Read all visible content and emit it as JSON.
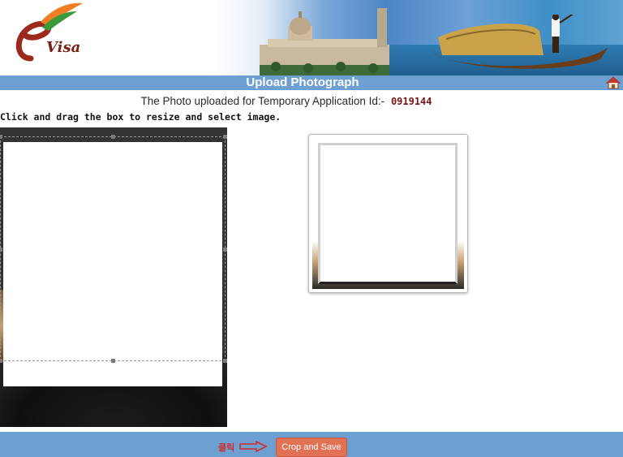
{
  "header": {
    "logo_text": "Visa",
    "page_title": "Upload Photograph"
  },
  "main": {
    "subtitle_prefix": "The Photo uploaded for Temporary Application Id:-",
    "application_id": "0919144",
    "instruction": "Click and drag the box to resize and select image."
  },
  "footer": {
    "annotation": "클릭",
    "crop_button_label": "Crop and Save"
  },
  "colors": {
    "title_bar": "#6e9fd1",
    "button": "#e27256",
    "app_id": "#7a1414",
    "annotation": "#d22b2b"
  },
  "icons": [
    "home-icon",
    "arrow-right-icon",
    "evisa-logo"
  ]
}
